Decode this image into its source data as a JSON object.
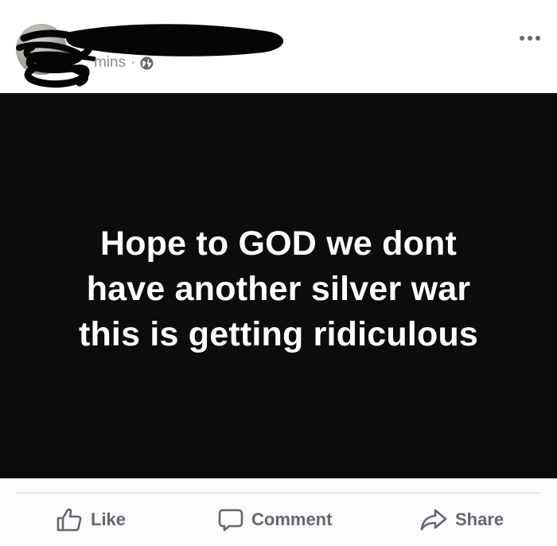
{
  "header": {
    "timestamp_suffix": "mins",
    "separator": "·",
    "privacy_icon": "globe-icon",
    "more_icon": "more-options-icon"
  },
  "post": {
    "lines": [
      "Hope to GOD we dont",
      "have another silver war",
      "this is getting ridiculous"
    ]
  },
  "actions": {
    "like_label": "Like",
    "comment_label": "Comment",
    "share_label": "Share"
  },
  "colors": {
    "post_background": "#0c0c0e",
    "post_text": "#ffffff",
    "action_text": "#65676b",
    "meta_text": "#8a8d91"
  }
}
